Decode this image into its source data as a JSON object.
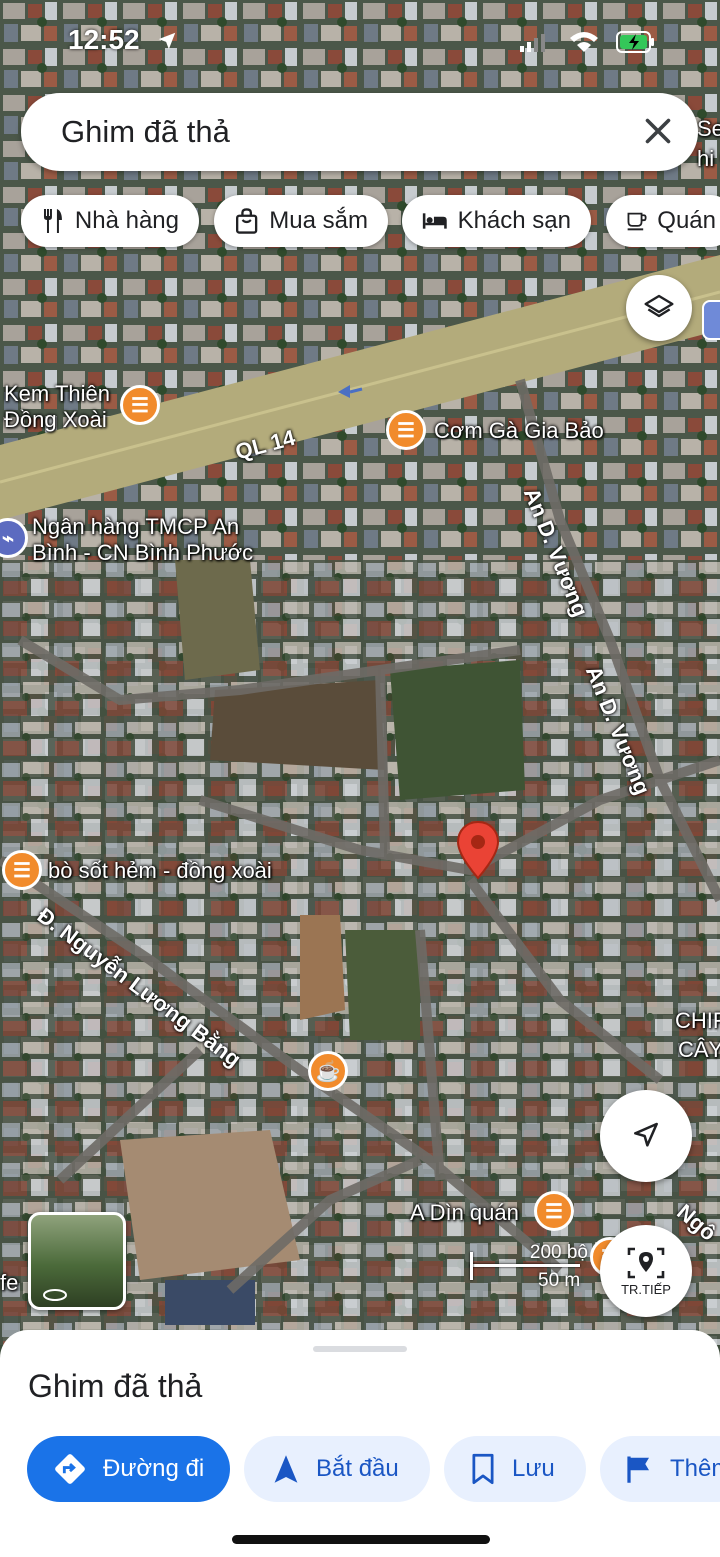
{
  "status_bar": {
    "time": "12:52"
  },
  "search": {
    "text": "Ghim đã thả"
  },
  "chips": [
    {
      "label": "Nhà hàng",
      "icon": "fork-knife-icon"
    },
    {
      "label": "Mua sắm",
      "icon": "shopping-bag-icon"
    },
    {
      "label": "Khách sạn",
      "icon": "bed-icon"
    },
    {
      "label": "Quán",
      "icon": "coffee-cup-icon"
    }
  ],
  "map": {
    "places": [
      {
        "line1": "Kem Thiên",
        "line2": "Đồng Xoài",
        "type": "restaurant"
      },
      {
        "line1": "Cơm Gà Gia Bảo",
        "type": "restaurant"
      },
      {
        "line1": "Ngân hàng TMCP An",
        "line2": "Bình - CN Bình Phước",
        "type": "bank"
      },
      {
        "line1": "bò sốt hẻm - đồng xoài",
        "type": "restaurant"
      },
      {
        "line1": "A Dìn quán",
        "type": "restaurant"
      }
    ],
    "cut_off_labels": [
      "Se",
      "hi C",
      "CHIF",
      "CÂY",
      "fe",
      "Ngô"
    ],
    "roads": [
      "QL 14",
      "An D. Vương",
      "An D. Vương",
      "Đ. Nguyễn Lương Bằng"
    ],
    "scale": {
      "imperial": "200 bộ",
      "metric": "50 m"
    },
    "streetview_label": "TR.TIẾP"
  },
  "sheet": {
    "title": "Ghim đã thả",
    "actions": [
      {
        "label": "Đường đi",
        "icon": "directions-icon"
      },
      {
        "label": "Bắt đầu",
        "icon": "navigation-arrow-icon"
      },
      {
        "label": "Lưu",
        "icon": "bookmark-icon"
      },
      {
        "label": "Thêm",
        "icon": "flag-icon"
      }
    ]
  },
  "colors": {
    "accent": "#1a73e8",
    "pin_red": "#ea4335",
    "poi_orange": "#f18b2c",
    "road_yellow": "#b4ad7a"
  }
}
